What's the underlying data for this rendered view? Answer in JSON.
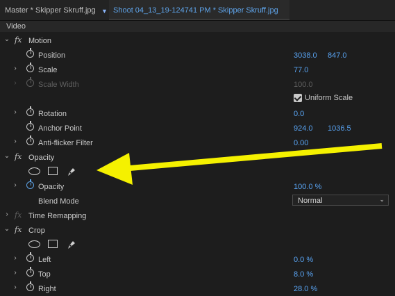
{
  "tabs": {
    "master": "Master * Skipper Skruff.jpg",
    "clip": "Shoot 04_13_19-124741 PM * Skipper Skruff.jpg"
  },
  "section": "Video",
  "groups": {
    "motion": "Motion",
    "opacity": "Opacity",
    "time_remapping": "Time Remapping",
    "crop": "Crop"
  },
  "params": {
    "position": {
      "label": "Position",
      "x": "3038.0",
      "y": "847.0"
    },
    "scale": {
      "label": "Scale",
      "value": "77.0"
    },
    "scale_width": {
      "label": "Scale Width",
      "value": "100.0"
    },
    "uniform_scale": {
      "label": "Uniform Scale",
      "checked": true
    },
    "rotation": {
      "label": "Rotation",
      "value": "0.0"
    },
    "anchor_point": {
      "label": "Anchor Point",
      "x": "924.0",
      "y": "1036.5"
    },
    "anti_flicker": {
      "label": "Anti-flicker Filter",
      "value": "0.00"
    },
    "opacity": {
      "label": "Opacity",
      "value": "100.0 %"
    },
    "blend_mode": {
      "label": "Blend Mode",
      "value": "Normal"
    },
    "crop_left": {
      "label": "Left",
      "value": "0.0 %"
    },
    "crop_top": {
      "label": "Top",
      "value": "8.0 %"
    },
    "crop_right": {
      "label": "Right",
      "value": "28.0 %"
    }
  },
  "icons": [
    "chevron-down-icon",
    "chevron-right-icon",
    "fx-icon",
    "stopwatch-icon",
    "ellipse-mask-icon",
    "rectangle-mask-icon",
    "pen-mask-icon",
    "checkbox-icon",
    "dropdown-chevron-icon"
  ],
  "colors": {
    "value_blue": "#58a2f0",
    "annotation_arrow": "#f5f100",
    "background": "#1d1d1d"
  }
}
